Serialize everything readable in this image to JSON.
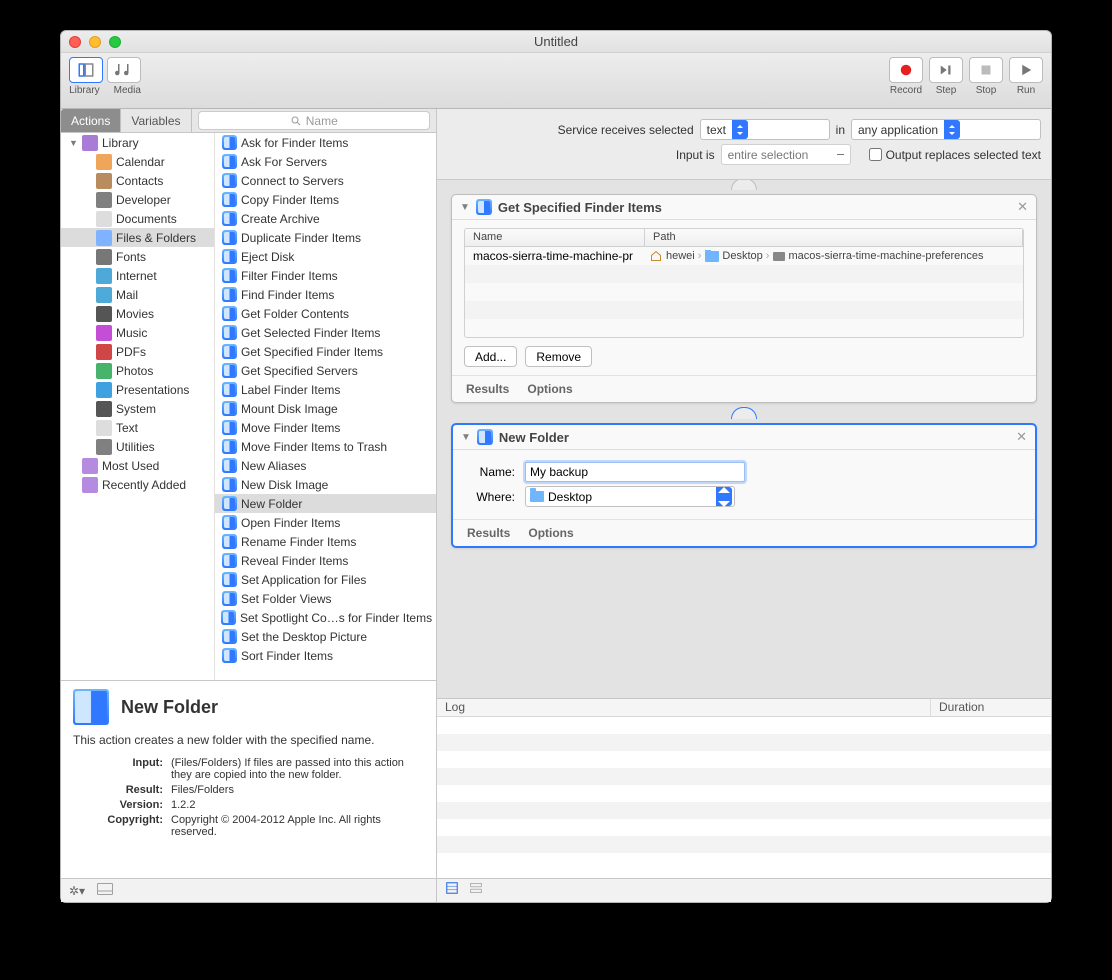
{
  "window": {
    "title": "Untitled"
  },
  "toolbar": {
    "library": "Library",
    "media": "Media",
    "record": "Record",
    "step": "Step",
    "stop": "Stop",
    "run": "Run"
  },
  "library": {
    "tab_actions": "Actions",
    "tab_variables": "Variables",
    "search_placeholder": "Name",
    "categories": [
      {
        "label": "Library",
        "indent": 0,
        "tri": "▼"
      },
      {
        "label": "Calendar",
        "indent": 1
      },
      {
        "label": "Contacts",
        "indent": 1
      },
      {
        "label": "Developer",
        "indent": 1
      },
      {
        "label": "Documents",
        "indent": 1
      },
      {
        "label": "Files & Folders",
        "indent": 1,
        "sel": true
      },
      {
        "label": "Fonts",
        "indent": 1
      },
      {
        "label": "Internet",
        "indent": 1
      },
      {
        "label": "Mail",
        "indent": 1
      },
      {
        "label": "Movies",
        "indent": 1
      },
      {
        "label": "Music",
        "indent": 1
      },
      {
        "label": "PDFs",
        "indent": 1
      },
      {
        "label": "Photos",
        "indent": 1
      },
      {
        "label": "Presentations",
        "indent": 1
      },
      {
        "label": "System",
        "indent": 1
      },
      {
        "label": "Text",
        "indent": 1
      },
      {
        "label": "Utilities",
        "indent": 1
      },
      {
        "label": "Most Used",
        "indent": 0
      },
      {
        "label": "Recently Added",
        "indent": 0
      }
    ],
    "actions": [
      "Ask for Finder Items",
      "Ask For Servers",
      "Connect to Servers",
      "Copy Finder Items",
      "Create Archive",
      "Duplicate Finder Items",
      "Eject Disk",
      "Filter Finder Items",
      "Find Finder Items",
      "Get Folder Contents",
      "Get Selected Finder Items",
      "Get Specified Finder Items",
      "Get Specified Servers",
      "Label Finder Items",
      "Mount Disk Image",
      "Move Finder Items",
      "Move Finder Items to Trash",
      "New Aliases",
      "New Disk Image",
      "New Folder",
      "Open Finder Items",
      "Rename Finder Items",
      "Reveal Finder Items",
      "Set Application for Files",
      "Set Folder Views",
      "Set Spotlight Co…s for Finder Items",
      "Set the Desktop Picture",
      "Sort Finder Items"
    ],
    "action_selected": "New Folder"
  },
  "description": {
    "title": "New Folder",
    "summary": "This action creates a new folder with the specified name.",
    "rows": {
      "Input": "(Files/Folders) If files are passed into this action they are copied into the new folder.",
      "Result": "Files/Folders",
      "Version": "1.2.2",
      "Copyright": "Copyright © 2004-2012 Apple Inc.  All rights reserved."
    }
  },
  "service": {
    "label": "Service receives selected",
    "type": "text",
    "in": "in",
    "app": "any application",
    "input_label": "Input is",
    "input_val": "entire selection",
    "replace_label": "Output replaces selected text"
  },
  "actionbox1": {
    "title": "Get Specified Finder Items",
    "cols": {
      "name": "Name",
      "path": "Path"
    },
    "row": {
      "name": "macos-sierra-time-machine-pr",
      "p1": "hewei",
      "p2": "Desktop",
      "p3": "macos-sierra-time-machine-preferences"
    },
    "add": "Add...",
    "remove": "Remove",
    "results": "Results",
    "options": "Options"
  },
  "actionbox2": {
    "title": "New Folder",
    "name_label": "Name:",
    "name_val": "My backup",
    "where_label": "Where:",
    "where_val": "Desktop",
    "results": "Results",
    "options": "Options"
  },
  "log": {
    "log": "Log",
    "duration": "Duration"
  }
}
